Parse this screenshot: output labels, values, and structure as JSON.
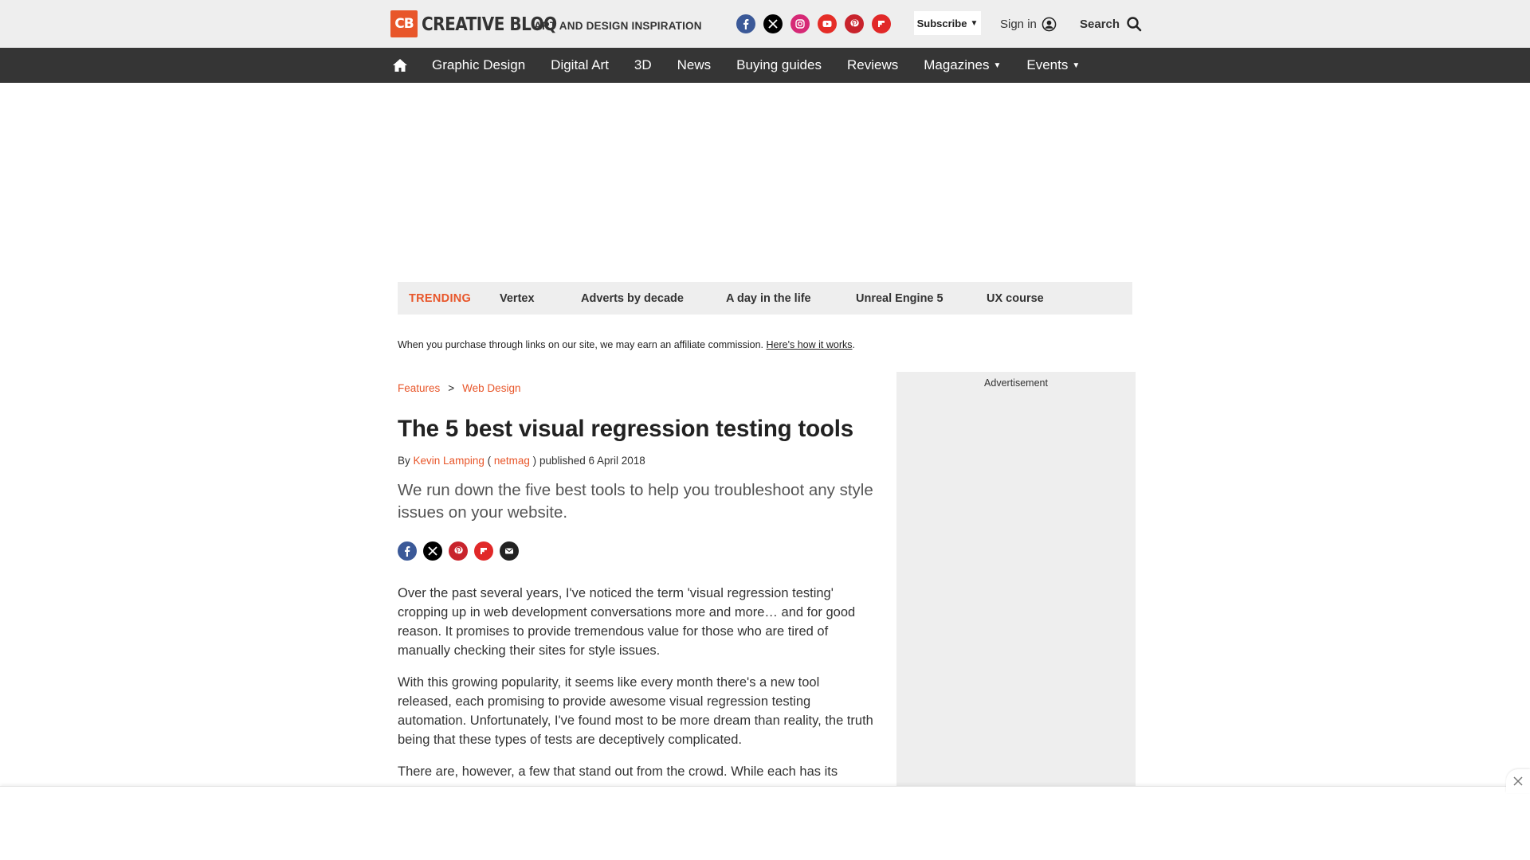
{
  "header": {
    "logo_mark": "CB",
    "logo_text": "CREATIVE BLOQ",
    "tagline": "ART AND DESIGN INSPIRATION",
    "socials": [
      {
        "name": "facebook",
        "glyph": "f",
        "color": "#3b5998"
      },
      {
        "name": "x",
        "glyph": "X",
        "color": "#000000"
      },
      {
        "name": "instagram",
        "glyph": "◎",
        "color": "#d62976"
      },
      {
        "name": "youtube",
        "glyph": "▶",
        "color": "#e52d27"
      },
      {
        "name": "pinterest",
        "glyph": "P",
        "color": "#c8232c"
      },
      {
        "name": "flipboard",
        "glyph": "F",
        "color": "#e12828"
      }
    ],
    "subscribe_label": "Subscribe",
    "signin_label": "Sign in",
    "search_label": "Search"
  },
  "nav": {
    "items": [
      {
        "label": "Graphic Design",
        "dropdown": false
      },
      {
        "label": "Digital Art",
        "dropdown": false
      },
      {
        "label": "3D",
        "dropdown": false
      },
      {
        "label": "News",
        "dropdown": false
      },
      {
        "label": "Buying guides",
        "dropdown": false
      },
      {
        "label": "Reviews",
        "dropdown": false
      },
      {
        "label": "Magazines",
        "dropdown": true
      },
      {
        "label": "Events",
        "dropdown": true
      }
    ]
  },
  "trending": {
    "label": "TRENDING",
    "items": [
      "Vertex",
      "Adverts by decade",
      "A day in the life",
      "Unreal Engine 5",
      "UX course"
    ]
  },
  "affiliate": {
    "text": "When you purchase through links on our site, we may earn an affiliate commission.",
    "link": "Here's how it works",
    "suffix": "."
  },
  "breadcrumb": {
    "items": [
      "Features",
      "Web Design"
    ],
    "separator": ">"
  },
  "article": {
    "title": "The 5 best visual regression testing tools",
    "by": "By",
    "author": "Kevin Lamping",
    "paren_open": "(",
    "publication": "netmag",
    "paren_close": ")",
    "published": "published 6 April 2018",
    "strapline": "We run down the five best tools to help you troubleshoot any style issues on your website.",
    "paragraphs": [
      "Over the past several years, I've noticed the term 'visual regression testing' cropping up in web development conversations more and more… and for good reason. It promises to provide tremendous value for those who are tired of manually checking their sites for style issues.",
      "With this growing popularity, it seems like every month there's a new tool released, each promising to provide awesome visual regression testing automation. Unfortunately, I've found most to be more dream than reality, the truth being that these types of tests are deceptively complicated.",
      "There are, however, a few that stand out from the crowd. While each has its"
    ]
  },
  "sidebar": {
    "ad_label": "Advertisement"
  },
  "colors": {
    "accent": "#e8562a",
    "nav_bg": "#353535",
    "header_bg": "#eeeeee"
  }
}
